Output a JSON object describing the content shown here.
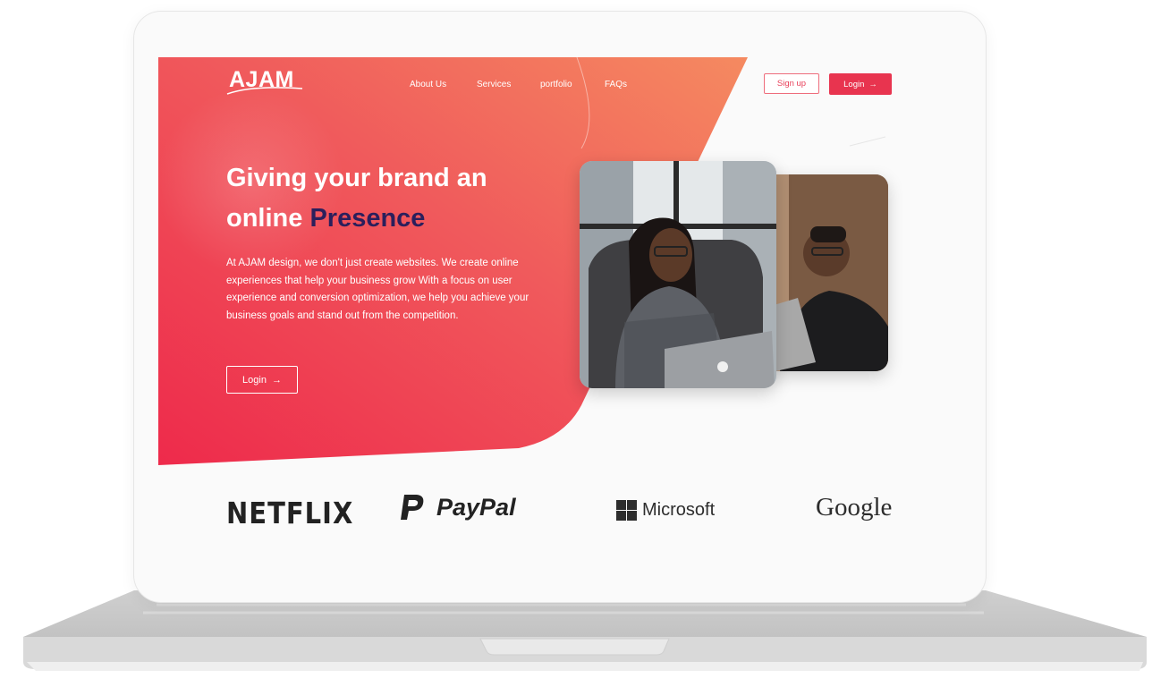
{
  "brand": {
    "logo": "AJAM"
  },
  "nav": {
    "items": [
      "About Us",
      "Services",
      "portfolio",
      "FAQs"
    ]
  },
  "header": {
    "signup_label": "Sign up",
    "login_label": "Login",
    "arrow": "→"
  },
  "hero": {
    "headline_part1": "Giving your brand an online ",
    "headline_accent": "Presence",
    "body": "At AJAM design, we don't just create websites. We create online experiences that help your business grow With a focus on user experience and conversion optimization, we help you achieve your business goals and stand out from the competition.",
    "login_label": "Login",
    "arrow": "→"
  },
  "partners": {
    "netflix": "NETFLIX",
    "paypal": "PayPal",
    "microsoft": "Microsoft",
    "google": "Google"
  },
  "colors": {
    "accent": "#e8344f",
    "gradient_start": "#ee2a4b",
    "gradient_end": "#f47a5e",
    "headline_accent": "#2b1f5c"
  }
}
